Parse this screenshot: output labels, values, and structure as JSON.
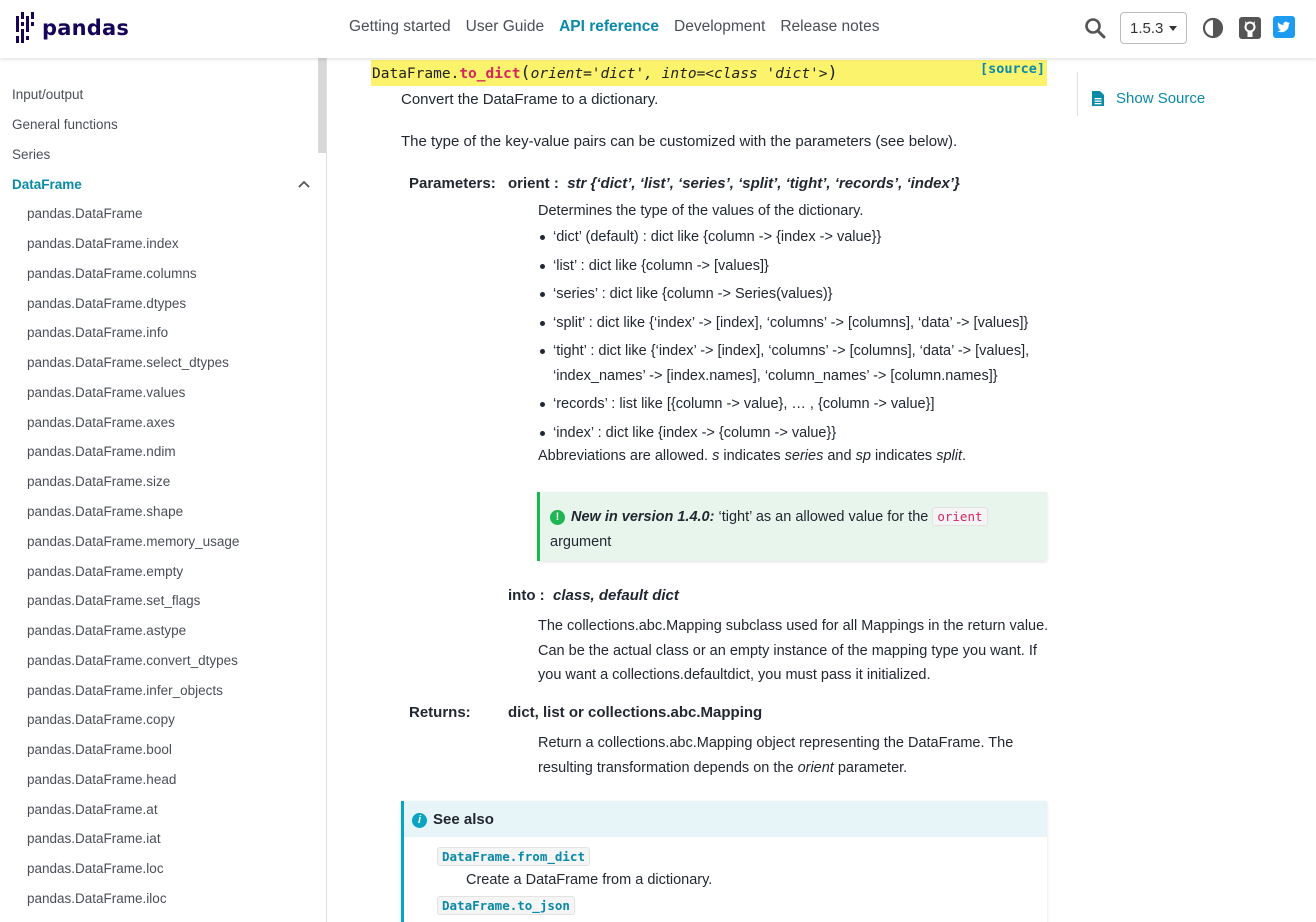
{
  "header": {
    "logo_text": "pandas",
    "nav": [
      "Getting started",
      "User Guide",
      "API reference",
      "Development",
      "Release notes"
    ],
    "active_nav": "API reference",
    "version": "1.5.3"
  },
  "sidebar": {
    "top_items": [
      "Input/output",
      "General functions",
      "Series",
      "DataFrame"
    ],
    "sub_items": [
      "pandas.DataFrame",
      "pandas.DataFrame.index",
      "pandas.DataFrame.columns",
      "pandas.DataFrame.dtypes",
      "pandas.DataFrame.info",
      "pandas.DataFrame.select_dtypes",
      "pandas.DataFrame.values",
      "pandas.DataFrame.axes",
      "pandas.DataFrame.ndim",
      "pandas.DataFrame.size",
      "pandas.DataFrame.shape",
      "pandas.DataFrame.memory_usage",
      "pandas.DataFrame.empty",
      "pandas.DataFrame.set_flags",
      "pandas.DataFrame.astype",
      "pandas.DataFrame.convert_dtypes",
      "pandas.DataFrame.infer_objects",
      "pandas.DataFrame.copy",
      "pandas.DataFrame.bool",
      "pandas.DataFrame.head",
      "pandas.DataFrame.at",
      "pandas.DataFrame.iat",
      "pandas.DataFrame.loc",
      "pandas.DataFrame.iloc"
    ]
  },
  "signature": {
    "class": "DataFrame.",
    "func": "to_dict",
    "open": "(",
    "p1": "orient",
    "v1": "='dict',",
    "p2": "into",
    "v2": "=<class 'dict'>",
    "close": ")",
    "source": "[source]"
  },
  "doc": {
    "summary": "Convert the DataFrame to a dictionary.",
    "extended": "The type of the key-value pairs can be customized with the parameters (see below).",
    "parameters_label": "Parameters:",
    "orient_name": "orient",
    "orient_sep": " : ",
    "orient_type": "str {‘dict’, ‘list’, ‘series’, ‘split’, ‘tight’, ‘records’, ‘index’}",
    "orient_desc": "Determines the type of the values of the dictionary.",
    "orient_options": [
      "‘dict’ (default) : dict like {column -> {index -> value}}",
      "‘list’ : dict like {column -> [values]}",
      "‘series’ : dict like {column -> Series(values)}",
      "‘split’ : dict like {‘index’ -> [index], ‘columns’ -> [columns], ‘data’ -> [values]}",
      "‘tight’ : dict like {‘index’ -> [index], ‘columns’ -> [columns], ‘data’ -> [values], ‘index_names’ -> [index.names], ‘column_names’ -> [column.names]}",
      "‘records’ : list like [{column -> value}, … , {column -> value}]",
      "‘index’ : dict like {index -> {column -> value}}"
    ],
    "abbrev": {
      "a": "Abbreviations are allowed. ",
      "s": "s",
      "b": " indicates ",
      "series": "series",
      "c": " and ",
      "sp": "sp",
      "d": " indicates ",
      "split": "split",
      "e": "."
    },
    "note": {
      "icon": "!",
      "label": "New in version 1.4.0:",
      "text": " ‘tight’ as an allowed value for the ",
      "code": "orient",
      "tail": " argument"
    },
    "into_name": "into",
    "into_sep": " : ",
    "into_type": "class, default dict",
    "into_desc": "The collections.abc.Mapping subclass used for all Mappings in the return value. Can be the actual class or an empty instance of the mapping type you want. If you want a collections.defaultdict, you must pass it initialized.",
    "returns_label": "Returns:",
    "returns_type": "dict, list or collections.abc.Mapping",
    "returns_desc_a": "Return a collections.abc.Mapping object representing the DataFrame. The resulting transformation depends on the ",
    "returns_desc_orient": "orient",
    "returns_desc_b": " parameter."
  },
  "see_also": {
    "icon": "i",
    "title": "See also",
    "items": [
      {
        "ref": "DataFrame.from_dict",
        "desc": "Create a DataFrame from a dictionary."
      },
      {
        "ref": "DataFrame.to_json",
        "desc": ""
      }
    ]
  },
  "toc": {
    "show_source": "Show Source"
  },
  "colors": {
    "accent": "#0a8aa8",
    "signature_bg": "#fbf36b",
    "function_name": "#d6245f",
    "note_green": "#1eb652",
    "info_blue": "#0aa3c2"
  }
}
